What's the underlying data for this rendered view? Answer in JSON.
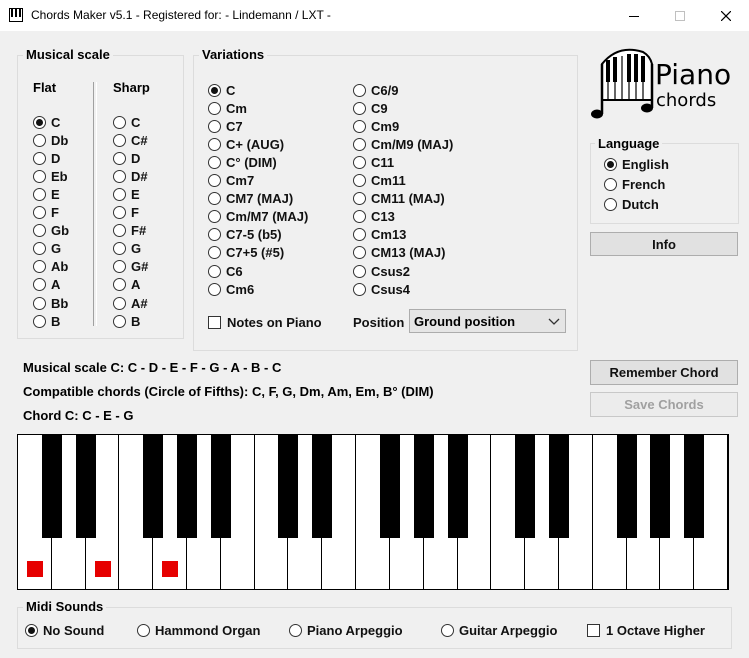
{
  "window": {
    "title": "Chords Maker v5.1 - Registered for: - Lindemann / LXT -",
    "controls": [
      "minimize",
      "maximize",
      "close"
    ]
  },
  "scale_group": {
    "label": "Musical scale",
    "flat_header": "Flat",
    "sharp_header": "Sharp",
    "flat": [
      "C",
      "Db",
      "D",
      "Eb",
      "E",
      "F",
      "Gb",
      "G",
      "Ab",
      "A",
      "Bb",
      "B"
    ],
    "sharp": [
      "C",
      "C#",
      "D",
      "D#",
      "E",
      "F",
      "F#",
      "G",
      "G#",
      "A",
      "A#",
      "B"
    ],
    "selected_flat": "C"
  },
  "variations": {
    "label": "Variations",
    "col1": [
      "C",
      "Cm",
      "C7",
      "C+ (AUG)",
      "C° (DIM)",
      "Cm7",
      "CM7 (MAJ)",
      "Cm/M7 (MAJ)",
      "C7-5 (b5)",
      "C7+5 (#5)",
      "C6",
      "Cm6"
    ],
    "col2": [
      "C6/9",
      "C9",
      "Cm9",
      "Cm/M9 (MAJ)",
      "C11",
      "Cm11",
      "CM11 (MAJ)",
      "C13",
      "Cm13",
      "CM13 (MAJ)",
      "Csus2",
      "Csus4"
    ],
    "selected": "C",
    "notes_on_piano": "Notes on Piano",
    "position_label": "Position",
    "position_value": "Ground position"
  },
  "logo": {
    "line1": "Piano",
    "line2": "chords"
  },
  "language": {
    "label": "Language",
    "options": [
      "English",
      "French",
      "Dutch"
    ],
    "selected": "English"
  },
  "buttons": {
    "info": "Info",
    "remember": "Remember Chord",
    "save": "Save Chords"
  },
  "info": {
    "scale_line": "Musical scale C:   C - D - E - F - G - A - B - C",
    "compatible_line": "Compatible chords (Circle of Fifths): C, F, G, Dm, Am, Em, B° (DIM)",
    "chord_line": "Chord C:   C - E - G"
  },
  "piano": {
    "white_keys": 21,
    "highlighted_notes": [
      "C",
      "E",
      "G"
    ],
    "marker_color": "#e60000"
  },
  "midi": {
    "label": "Midi Sounds",
    "options": [
      "No Sound",
      "Hammond Organ",
      "Piano Arpeggio",
      "Guitar Arpeggio"
    ],
    "selected": "No Sound",
    "octave_checkbox": "1 Octave Higher"
  }
}
